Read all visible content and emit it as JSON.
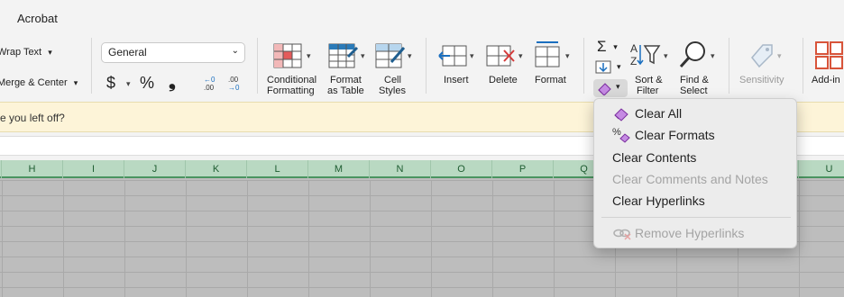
{
  "ribbon": {
    "tab_title": "Acrobat",
    "wrap_text": "Wrap Text",
    "merge_center": "Merge & Center",
    "number_format": "General",
    "currency_symbol": "$",
    "percent_symbol": "%",
    "comma_symbol": "❟",
    "conditional_formatting": [
      "Conditional",
      "Formatting"
    ],
    "format_as_table": [
      "Format",
      "as Table"
    ],
    "cell_styles": [
      "Cell",
      "Styles"
    ],
    "insert": "Insert",
    "delete": "Delete",
    "format": "Format",
    "sort_filter": [
      "Sort &",
      "Filter"
    ],
    "find_select": [
      "Find &",
      "Select"
    ],
    "sensitivity": "Sensitivity",
    "addins": "Add-in"
  },
  "banner": {
    "text": "e you left off?"
  },
  "columns": [
    "H",
    "I",
    "J",
    "K",
    "L",
    "M",
    "N",
    "O",
    "P",
    "Q",
    "U"
  ],
  "clear_menu": {
    "items": [
      {
        "label": "Clear All",
        "enabled": true,
        "icon": "eraser-icon"
      },
      {
        "label": "Clear Formats",
        "enabled": true,
        "icon": "clear-formats-icon"
      },
      {
        "label": "Clear Contents",
        "enabled": true,
        "icon": ""
      },
      {
        "label": "Clear Comments and Notes",
        "enabled": false,
        "icon": ""
      },
      {
        "label": "Clear Hyperlinks",
        "enabled": true,
        "icon": ""
      },
      {
        "label": "Remove Hyperlinks",
        "enabled": false,
        "icon": "remove-link-icon"
      }
    ]
  },
  "colors": {
    "accent_purple": "#9b3fc6",
    "header_green": "#b9d9c2",
    "banner_yellow": "#fdf4d8"
  }
}
